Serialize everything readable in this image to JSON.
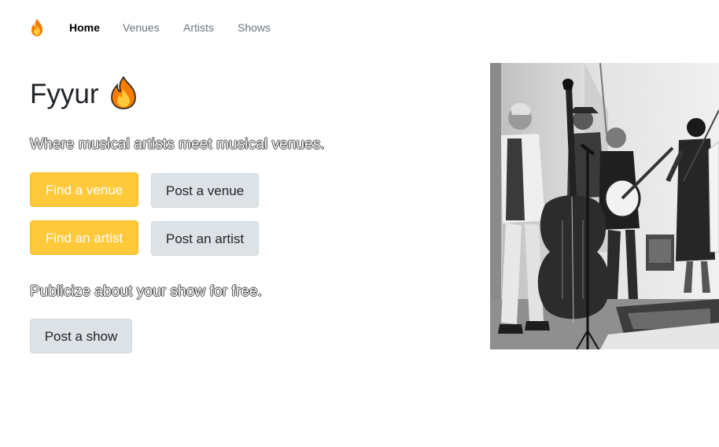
{
  "navbar": {
    "brand_icon": "fire-icon",
    "links": [
      {
        "label": "Home",
        "active": true
      },
      {
        "label": "Venues",
        "active": false
      },
      {
        "label": "Artists",
        "active": false
      },
      {
        "label": "Shows",
        "active": false
      }
    ]
  },
  "hero": {
    "title": "Fyyur",
    "title_icon": "fire-icon",
    "tagline": "Where musical artists meet musical venues.",
    "buttons_row1": [
      "Find a venue",
      "Post a venue"
    ],
    "buttons_row2": [
      "Find an artist",
      "Post an artist"
    ],
    "publicize_text": "Publicize about your show for free.",
    "post_show_label": "Post a show"
  },
  "image": {
    "description_icon": "band-photo",
    "style": "black-and-white"
  },
  "colors": {
    "accent": "#ffc93c",
    "light_button": "#dde2e6",
    "nav_muted": "#6c757d",
    "text": "#212529"
  }
}
